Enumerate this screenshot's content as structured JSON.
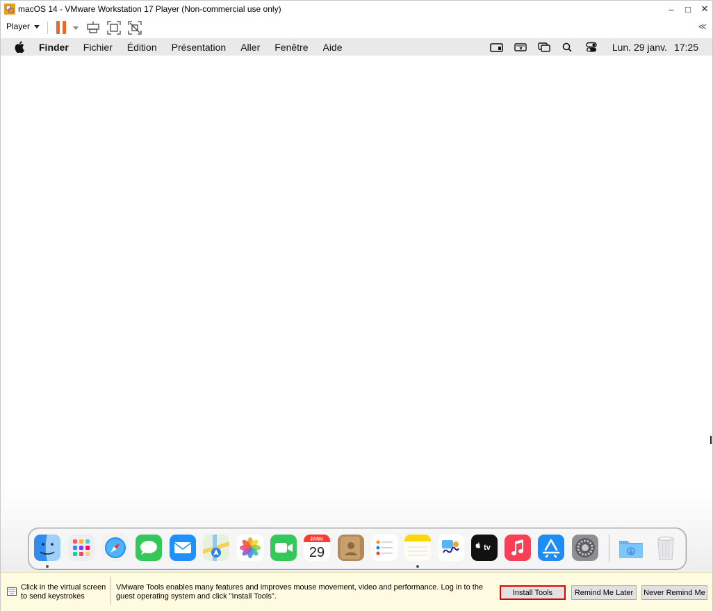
{
  "window": {
    "title": "macOS 14 - VMware Workstation 17 Player (Non-commercial use only)",
    "controls": {
      "minimize": "–",
      "maximize": "□",
      "close": "✕"
    }
  },
  "toolbar": {
    "player_label": "Player",
    "collapse_label": "≪",
    "pause_color": "#f26522"
  },
  "mac_menubar": {
    "menus": [
      "Finder",
      "Fichier",
      "Édition",
      "Présentation",
      "Aller",
      "Fenêtre",
      "Aide"
    ],
    "status_icons": [
      "screen-mirroring-icon",
      "keyboard-input-icon",
      "window-stage-icon",
      "spotlight-search-icon",
      "control-center-icon"
    ],
    "clock_date": "Lun. 29 janv.",
    "clock_time": "17:25"
  },
  "dock": {
    "apps": [
      {
        "name": "Finder",
        "icon": "finder-icon",
        "running": true
      },
      {
        "name": "Launchpad",
        "icon": "launchpad-icon",
        "running": false
      },
      {
        "name": "Safari",
        "icon": "safari-icon",
        "running": false
      },
      {
        "name": "Messages",
        "icon": "messages-icon",
        "running": false
      },
      {
        "name": "Mail",
        "icon": "mail-icon",
        "running": false
      },
      {
        "name": "Plans",
        "icon": "maps-icon",
        "running": false
      },
      {
        "name": "Photos",
        "icon": "photos-icon",
        "running": false
      },
      {
        "name": "FaceTime",
        "icon": "facetime-icon",
        "running": false
      },
      {
        "name": "Calendrier",
        "icon": "calendar-icon",
        "running": false
      },
      {
        "name": "Contacts",
        "icon": "contacts-icon",
        "running": false
      },
      {
        "name": "Rappels",
        "icon": "reminders-icon",
        "running": false
      },
      {
        "name": "Notes",
        "icon": "notes-icon",
        "running": true
      },
      {
        "name": "Freeform",
        "icon": "freeform-icon",
        "running": false
      },
      {
        "name": "TV",
        "icon": "apple-tv-icon",
        "running": false
      },
      {
        "name": "Musique",
        "icon": "music-icon",
        "running": false
      },
      {
        "name": "App Store",
        "icon": "app-store-icon",
        "running": false
      },
      {
        "name": "Réglages Système",
        "icon": "system-settings-icon",
        "running": false
      }
    ],
    "calendar_month": "JANV.",
    "calendar_day": "29",
    "tv_label": "tv",
    "downloads_icon": "downloads-folder-icon",
    "trash_icon": "trash-icon"
  },
  "notification": {
    "click_hint": "Click in the virtual screen to send keystrokes",
    "message": "VMware Tools enables many features and improves mouse movement, video and performance. Log in to the guest operating system and click \"Install Tools\".",
    "install_label": "Install Tools",
    "remind_later_label": "Remind Me Later",
    "never_remind_label": "Never Remind Me",
    "highlight_color": "#e00000"
  }
}
